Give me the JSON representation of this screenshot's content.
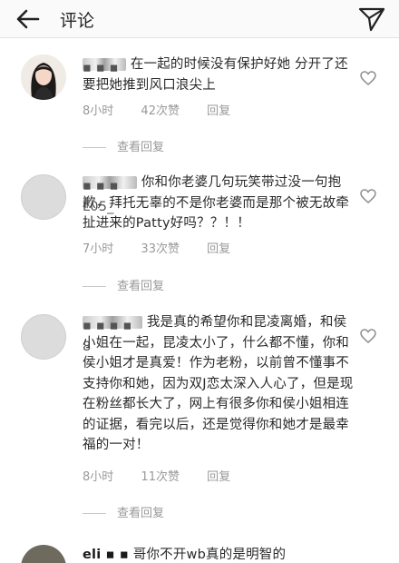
{
  "header": {
    "title": "评论"
  },
  "comments": [
    {
      "username": "▪ ▪ ▪",
      "text": "在一起的时候没有保护好她 分开了还要把她推到风口浪尖上",
      "time": "8小时",
      "likes": "42次赞",
      "reply": "回复",
      "view_replies": "查看回复"
    },
    {
      "username": "▪ ▪ ▪ L05_",
      "text": "你和你老婆几句玩笑带过没一句抱歉，拜托无辜的不是你老婆而是那个被无故牵扯进来的Patty好吗？？！！",
      "time": "7小时",
      "likes": "33次赞",
      "reply": "回复",
      "view_replies": "查看回复"
    },
    {
      "username": "▪ ▪ ▪ ▪ 8",
      "text": "我是真的希望你和昆凌离婚，和侯小姐在一起，昆凌太小了，什么都不懂，你和侯小姐才是真爱！作为老粉，以前曾不懂事不支持你和她，因为双J恋太深入人心了，但是现在粉丝都长大了，网上有很多你和侯小姐相连的证据，看完以后，还是觉得你和她才是最幸福的一对！",
      "time": "8小时",
      "likes": "11次赞",
      "reply": "回复",
      "view_replies": "查看回复"
    },
    {
      "username": "eli ▪ ▪",
      "text": "哥你不开wb真的是明智的"
    }
  ]
}
